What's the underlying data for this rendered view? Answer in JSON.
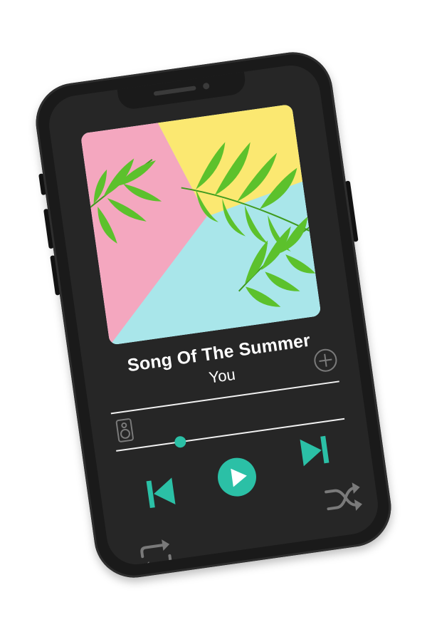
{
  "player": {
    "title": "Song Of The Summer",
    "artist": "You",
    "progress": 0.28
  },
  "colors": {
    "accent": "#2bc0a6",
    "muted_icon": "#7a7a7a",
    "text": "#ffffff",
    "art_pink": "#f4a7bf",
    "art_yellow": "#fbe871",
    "art_blue": "#a9e6ea",
    "leaf_green": "#5cc12c"
  },
  "icons": {
    "add": "plus-circle-icon",
    "speaker": "speaker-icon",
    "previous": "skip-previous-icon",
    "play": "play-icon",
    "next": "skip-next-icon",
    "shuffle": "shuffle-icon",
    "repeat": "repeat-icon"
  }
}
